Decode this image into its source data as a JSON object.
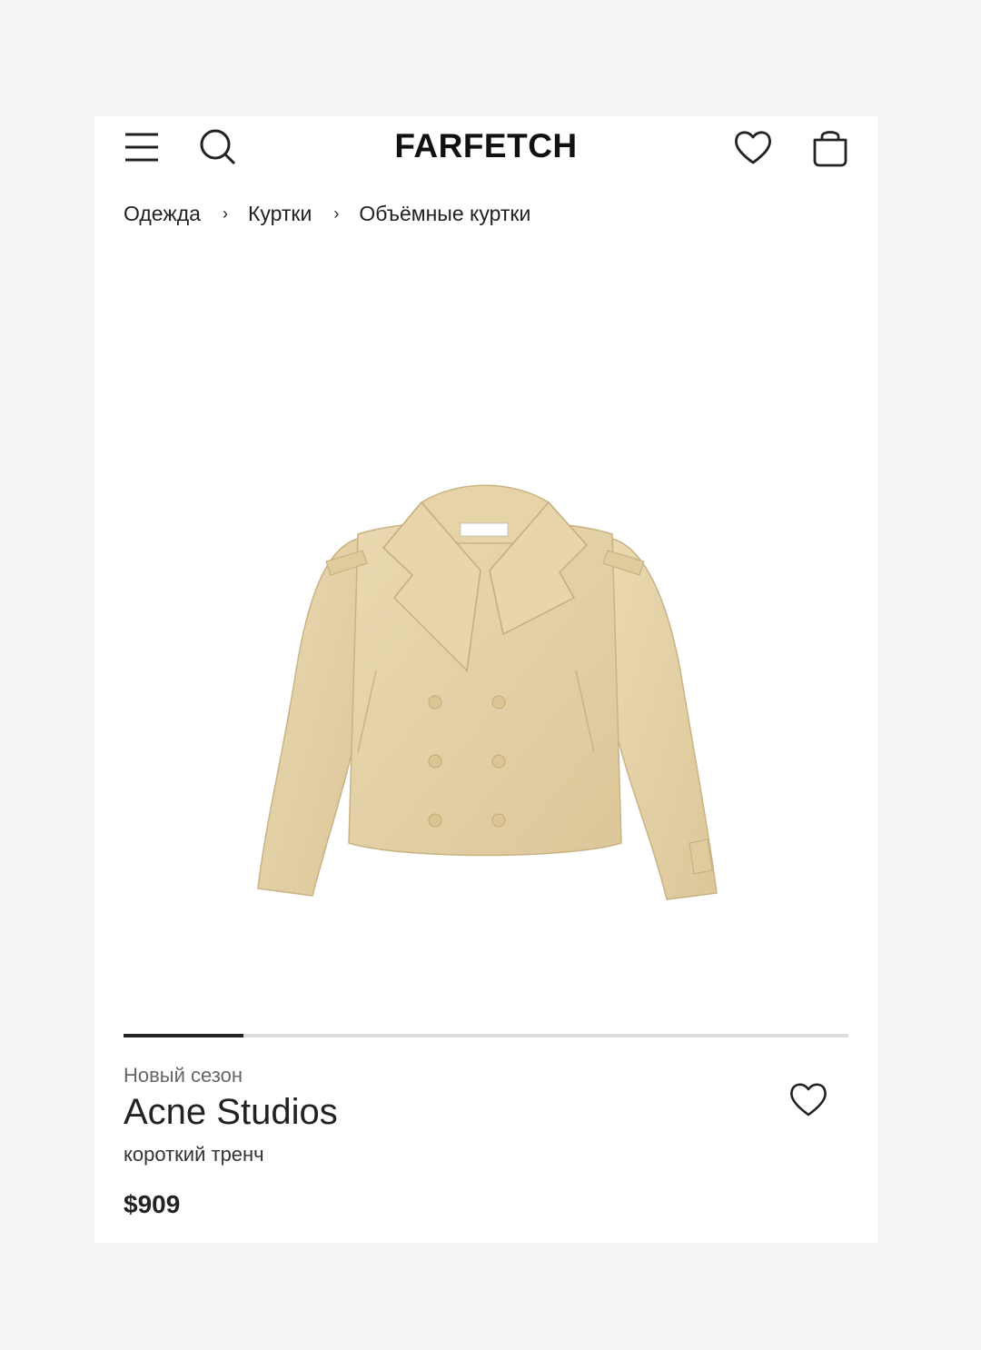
{
  "header": {
    "logo": "FARFETCH",
    "icons": [
      "menu-icon",
      "search-icon",
      "heart-icon",
      "bag-icon"
    ]
  },
  "breadcrumb": {
    "items": [
      "Одежда",
      "Куртки",
      "Объёмные куртки"
    ],
    "separator": "›"
  },
  "gallery": {
    "progress": 0.165
  },
  "product": {
    "season": "Новый сезон",
    "brand": "Acne Studios",
    "description": "короткий тренч",
    "price": "$909",
    "image_icon": "trench-coat-image"
  },
  "colors": {
    "background": "#f5f5f5",
    "card": "#ffffff",
    "text": "#222222",
    "muted": "#666666",
    "jacket": "#e3cfa3"
  }
}
